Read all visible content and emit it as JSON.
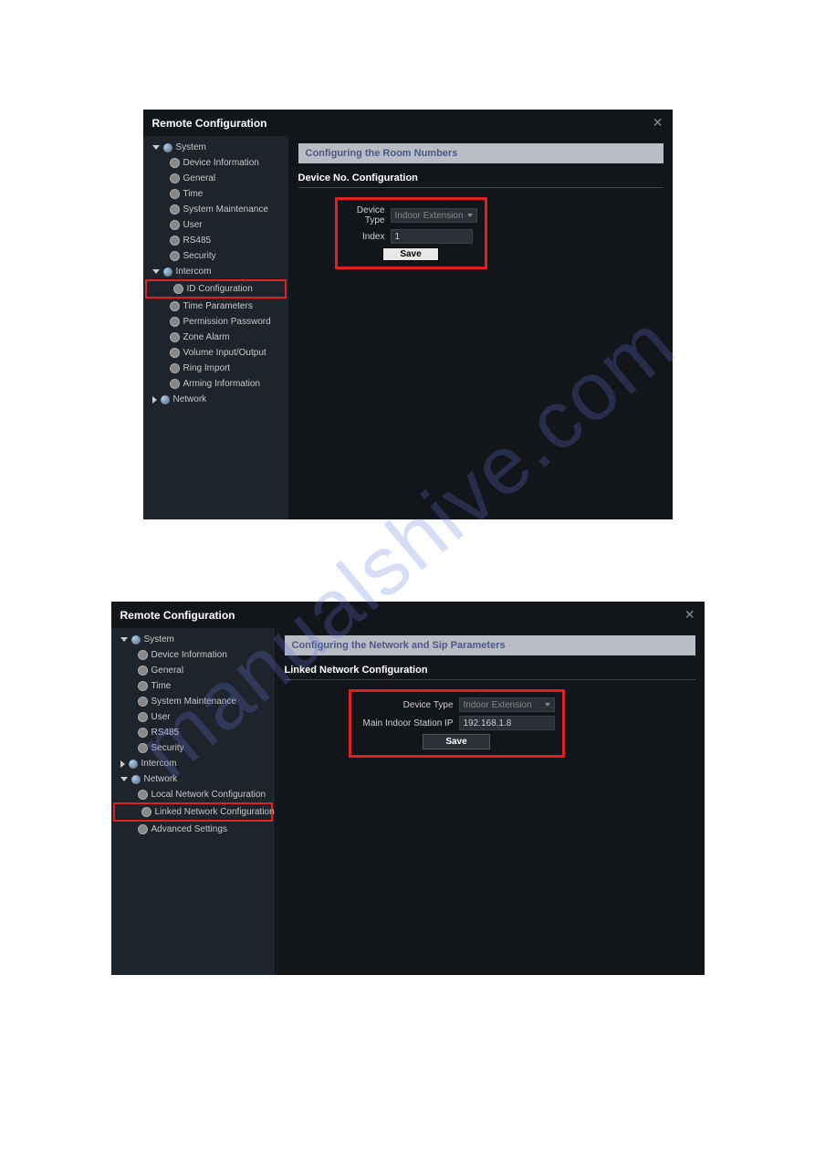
{
  "watermark": "manualshive.com",
  "window1": {
    "title": "Remote Configuration",
    "sidebar": {
      "system": {
        "label": "System",
        "expanded": true
      },
      "system_items": [
        "Device Information",
        "General",
        "Time",
        "System Maintenance",
        "User",
        "RS485",
        "Security"
      ],
      "intercom": {
        "label": "Intercom",
        "expanded": true
      },
      "intercom_items": [
        "ID Configuration",
        "Time Parameters",
        "Permission Password",
        "Zone Alarm",
        "Volume Input/Output",
        "Ring Import",
        "Arming Information"
      ],
      "network": {
        "label": "Network",
        "expanded": false
      }
    },
    "banner": "Configuring the Room Numbers",
    "section": "Device No. Configuration",
    "form": {
      "device_type_label": "Device Type",
      "device_type_value": "Indoor Extension",
      "index_label": "Index",
      "index_value": "1",
      "save": "Save"
    }
  },
  "window2": {
    "title": "Remote Configuration",
    "sidebar": {
      "system": {
        "label": "System",
        "expanded": true
      },
      "system_items": [
        "Device Information",
        "General",
        "Time",
        "System Maintenance",
        "User",
        "RS485",
        "Security"
      ],
      "intercom": {
        "label": "Intercom",
        "expanded": false
      },
      "network": {
        "label": "Network",
        "expanded": true
      },
      "network_items": [
        "Local Network Configuration",
        "Linked Network Configuration",
        "Advanced Settings"
      ]
    },
    "banner": "Configuring the Network and Sip Parameters",
    "section": "Linked Network Configuration",
    "form": {
      "device_type_label": "Device Type",
      "device_type_value": "Indoor Extension",
      "ip_label": "Main Indoor Station IP",
      "ip_value": "192.168.1.8",
      "save": "Save"
    }
  }
}
